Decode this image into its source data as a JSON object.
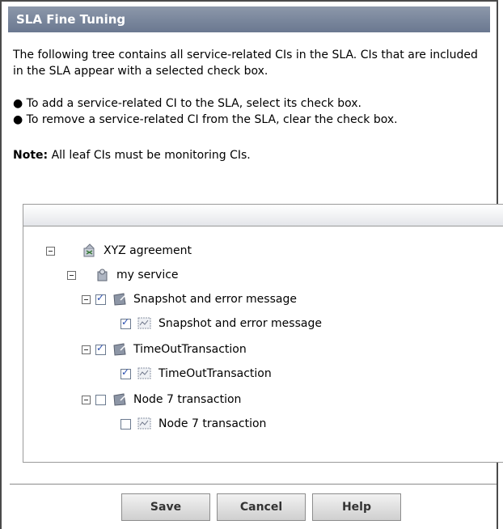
{
  "title": "SLA Fine Tuning",
  "intro": "The following tree contains all service-related CIs in the SLA. CIs that are included in the SLA appear with a selected check box.",
  "bullets": [
    "To add a service-related CI to the SLA, select its check box.",
    "To remove a service-related CI from the SLA, clear the check box."
  ],
  "note_label": "Note:",
  "note_text": "All leaf CIs must be monitoring CIs.",
  "tree": {
    "items": [
      {
        "label": "XYZ agreement",
        "level": 0,
        "expander": true,
        "checkbox": false,
        "checked": false,
        "icon": "agreement-icon"
      },
      {
        "label": "my service",
        "level": 1,
        "expander": true,
        "checkbox": false,
        "checked": false,
        "icon": "service-icon"
      },
      {
        "label": "Snapshot and error message",
        "level": 2,
        "expander": true,
        "checkbox": true,
        "checked": true,
        "icon": "transaction-group-icon"
      },
      {
        "label": "Snapshot and error message",
        "level": 3,
        "expander": false,
        "checkbox": true,
        "checked": true,
        "icon": "monitor-icon"
      },
      {
        "label": "TimeOutTransaction",
        "level": 2,
        "expander": true,
        "checkbox": true,
        "checked": true,
        "icon": "transaction-group-icon"
      },
      {
        "label": "TimeOutTransaction",
        "level": 3,
        "expander": false,
        "checkbox": true,
        "checked": true,
        "icon": "monitor-icon"
      },
      {
        "label": "Node 7 transaction",
        "level": 2,
        "expander": true,
        "checkbox": true,
        "checked": false,
        "icon": "transaction-group-icon"
      },
      {
        "label": "Node 7 transaction",
        "level": 3,
        "expander": false,
        "checkbox": true,
        "checked": false,
        "icon": "monitor-icon"
      }
    ]
  },
  "buttons": {
    "save": "Save",
    "cancel": "Cancel",
    "help": "Help"
  }
}
